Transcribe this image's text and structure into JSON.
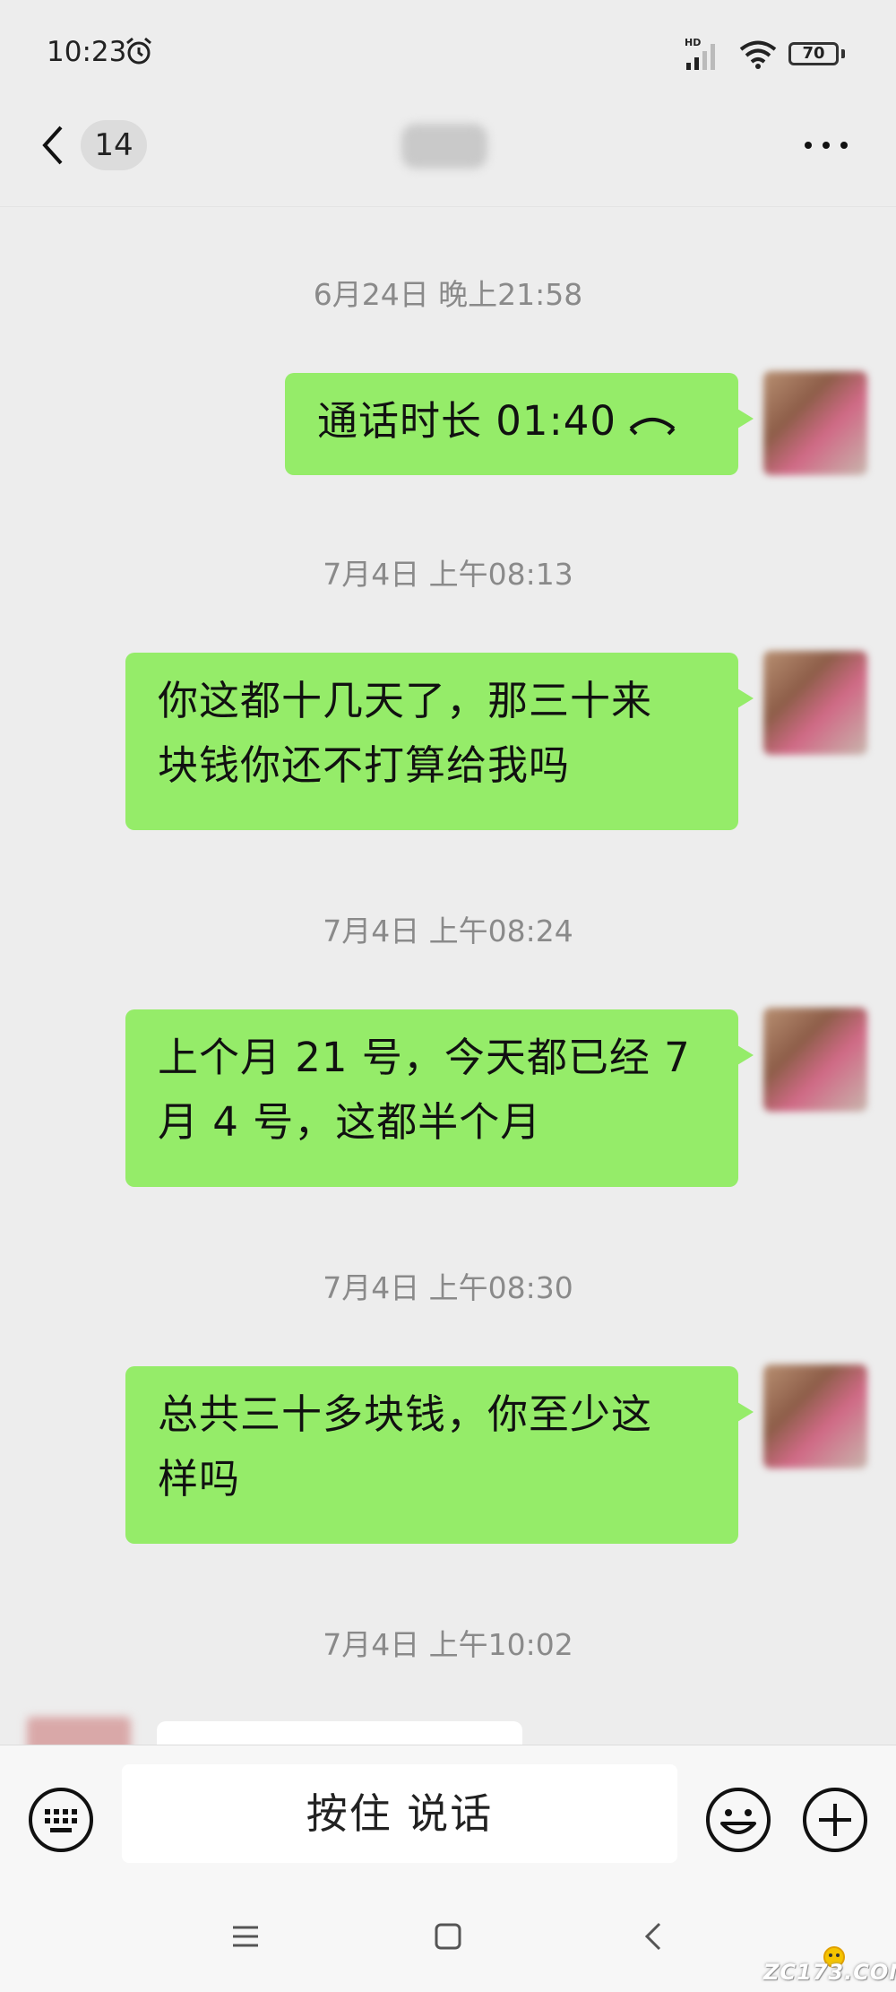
{
  "status_bar": {
    "time": "10:23",
    "network": "HD",
    "battery": "70"
  },
  "header": {
    "unread_count": "14"
  },
  "messages": [
    {
      "timestamp": "6月24日 晚上21:58",
      "text": "通话时长 01:40",
      "type": "call"
    },
    {
      "timestamp": "7月4日 上午08:13",
      "lines": [
        "你这都十几天了，那三十来",
        "块钱你还不打算给我吗"
      ]
    },
    {
      "timestamp": "7月4日 上午08:24",
      "lines": [
        "上个月 21 号，今天都已经 7",
        "月 4 号，这都半个月"
      ]
    },
    {
      "timestamp": "7月4日 上午08:30",
      "lines": [
        "总共三十多块钱，你至少这",
        "样吗"
      ]
    },
    {
      "timestamp": "7月4日 上午10:02"
    }
  ],
  "input_bar": {
    "voice_label": "按住 说话"
  },
  "watermark": "ZC173.COM",
  "colors": {
    "bubble": "#95ec69",
    "background": "#ededed",
    "timestamp": "#8a8a8a"
  }
}
